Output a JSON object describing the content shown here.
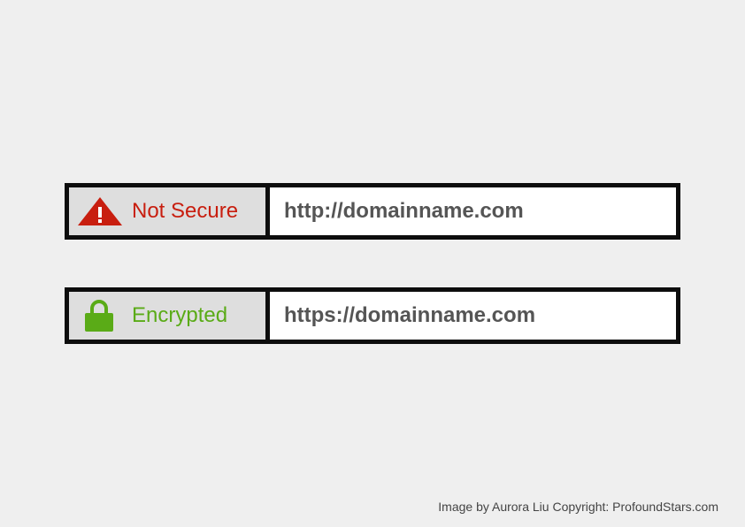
{
  "bars": {
    "insecure": {
      "status_label": "Not Secure",
      "status_icon": "warning-triangle-icon",
      "status_color": "#c81e0f",
      "url": "http://domainname.com"
    },
    "secure": {
      "status_label": "Encrypted",
      "status_icon": "padlock-icon",
      "status_color": "#5aab17",
      "url": "https://domainname.com"
    }
  },
  "credit": "Image by Aurora Liu Copyright: ProfoundStars.com",
  "colors": {
    "background": "#efefef",
    "border": "#0d0d0d",
    "status_panel": "#dedede",
    "url_text": "#555555"
  }
}
